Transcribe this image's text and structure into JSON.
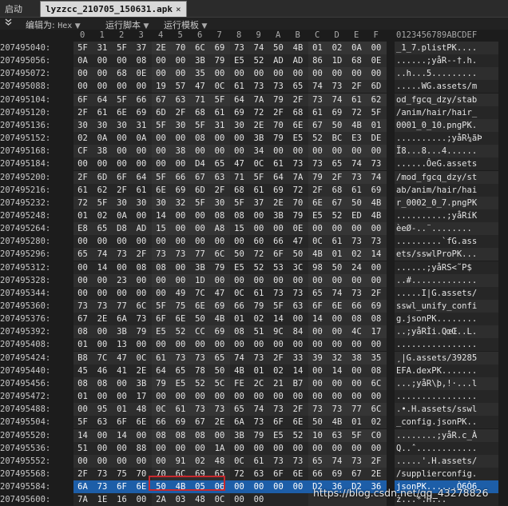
{
  "tabs": {
    "start_label": "启动",
    "file_label": "lyzzcc_210705_150631.apk",
    "close_glyph": "×"
  },
  "toolbar": {
    "edit_as_label": "编辑为:",
    "edit_as_value": "Hex",
    "run_script_label": "运行脚本",
    "run_template_label": "运行模板"
  },
  "ruler": {
    "hex_columns": [
      "0",
      "1",
      "2",
      "3",
      "4",
      "5",
      "6",
      "7",
      "8",
      "9",
      "A",
      "B",
      "C",
      "D",
      "E",
      "F"
    ],
    "ascii_header": "0123456789ABCDEF"
  },
  "rows": [
    {
      "addr": "207495040:",
      "hex": [
        "5F",
        "31",
        "5F",
        "37",
        "2E",
        "70",
        "6C",
        "69",
        "73",
        "74",
        "50",
        "4B",
        "01",
        "02",
        "0A",
        "00"
      ],
      "ascii": "_1_7.plistPK...."
    },
    {
      "addr": "207495056:",
      "hex": [
        "0A",
        "00",
        "00",
        "08",
        "00",
        "00",
        "3B",
        "79",
        "E5",
        "52",
        "AD",
        "AD",
        "86",
        "1D",
        "68",
        "0E"
      ],
      "ascii": "......;yåR--†.h."
    },
    {
      "addr": "207495072:",
      "hex": [
        "00",
        "00",
        "68",
        "0E",
        "00",
        "00",
        "35",
        "00",
        "00",
        "00",
        "00",
        "00",
        "00",
        "00",
        "00",
        "00"
      ],
      "ascii": "..h...5........."
    },
    {
      "addr": "207495088:",
      "hex": [
        "00",
        "00",
        "00",
        "00",
        "19",
        "57",
        "47",
        "0C",
        "61",
        "73",
        "73",
        "65",
        "74",
        "73",
        "2F",
        "6D"
      ],
      "ascii": ".....WG.assets/m"
    },
    {
      "addr": "207495104:",
      "hex": [
        "6F",
        "64",
        "5F",
        "66",
        "67",
        "63",
        "71",
        "5F",
        "64",
        "7A",
        "79",
        "2F",
        "73",
        "74",
        "61",
        "62"
      ],
      "ascii": "od_fgcq_dzy/stab"
    },
    {
      "addr": "207495120:",
      "hex": [
        "2F",
        "61",
        "6E",
        "69",
        "6D",
        "2F",
        "68",
        "61",
        "69",
        "72",
        "2F",
        "68",
        "61",
        "69",
        "72",
        "5F"
      ],
      "ascii": "/anim/hair/hair_"
    },
    {
      "addr": "207495136:",
      "hex": [
        "30",
        "30",
        "30",
        "31",
        "5F",
        "30",
        "5F",
        "31",
        "30",
        "2E",
        "70",
        "6E",
        "67",
        "50",
        "4B",
        "01"
      ],
      "ascii": "0001_0_10.pngPK."
    },
    {
      "addr": "207495152:",
      "hex": [
        "02",
        "0A",
        "00",
        "0A",
        "00",
        "00",
        "08",
        "00",
        "00",
        "3B",
        "79",
        "E5",
        "52",
        "BC",
        "E3",
        "DE"
      ],
      "ascii": "..........;yåR¼ãÞ"
    },
    {
      "addr": "207495168:",
      "hex": [
        "CF",
        "38",
        "00",
        "00",
        "00",
        "38",
        "00",
        "00",
        "00",
        "34",
        "00",
        "00",
        "00",
        "00",
        "00",
        "00"
      ],
      "ascii": "Ï8...8...4......"
    },
    {
      "addr": "207495184:",
      "hex": [
        "00",
        "00",
        "00",
        "00",
        "00",
        "00",
        "D4",
        "65",
        "47",
        "0C",
        "61",
        "73",
        "73",
        "65",
        "74",
        "73"
      ],
      "ascii": "......ÔeG.assets"
    },
    {
      "addr": "207495200:",
      "hex": [
        "2F",
        "6D",
        "6F",
        "64",
        "5F",
        "66",
        "67",
        "63",
        "71",
        "5F",
        "64",
        "7A",
        "79",
        "2F",
        "73",
        "74"
      ],
      "ascii": "/mod_fgcq_dzy/st"
    },
    {
      "addr": "207495216:",
      "hex": [
        "61",
        "62",
        "2F",
        "61",
        "6E",
        "69",
        "6D",
        "2F",
        "68",
        "61",
        "69",
        "72",
        "2F",
        "68",
        "61",
        "69"
      ],
      "ascii": "ab/anim/hair/hai"
    },
    {
      "addr": "207495232:",
      "hex": [
        "72",
        "5F",
        "30",
        "30",
        "30",
        "32",
        "5F",
        "30",
        "5F",
        "37",
        "2E",
        "70",
        "6E",
        "67",
        "50",
        "4B"
      ],
      "ascii": "r_0002_0_7.pngPK"
    },
    {
      "addr": "207495248:",
      "hex": [
        "01",
        "02",
        "0A",
        "00",
        "14",
        "00",
        "00",
        "08",
        "08",
        "00",
        "3B",
        "79",
        "E5",
        "52",
        "ED",
        "4B"
      ],
      "ascii": "..........;yåRíK"
    },
    {
      "addr": "207495264:",
      "hex": [
        "E8",
        "65",
        "D8",
        "AD",
        "15",
        "00",
        "00",
        "A8",
        "15",
        "00",
        "00",
        "0E",
        "00",
        "00",
        "00",
        "00"
      ],
      "ascii": "èeØ-..¨........"
    },
    {
      "addr": "207495280:",
      "hex": [
        "00",
        "00",
        "00",
        "00",
        "00",
        "00",
        "00",
        "00",
        "00",
        "60",
        "66",
        "47",
        "0C",
        "61",
        "73",
        "73"
      ],
      "ascii": ".........`fG.ass"
    },
    {
      "addr": "207495296:",
      "hex": [
        "65",
        "74",
        "73",
        "2F",
        "73",
        "73",
        "77",
        "6C",
        "50",
        "72",
        "6F",
        "50",
        "4B",
        "01",
        "02",
        "14"
      ],
      "ascii": "ets/sswlProPK..."
    },
    {
      "addr": "207495312:",
      "hex": [
        "00",
        "14",
        "00",
        "08",
        "08",
        "00",
        "3B",
        "79",
        "E5",
        "52",
        "53",
        "3C",
        "98",
        "50",
        "24",
        "00"
      ],
      "ascii": "......;yåRS<˜P$"
    },
    {
      "addr": "207495328:",
      "hex": [
        "00",
        "00",
        "23",
        "00",
        "00",
        "00",
        "1D",
        "00",
        "00",
        "00",
        "00",
        "00",
        "00",
        "00",
        "00",
        "00"
      ],
      "ascii": "..#............."
    },
    {
      "addr": "207495344:",
      "hex": [
        "00",
        "00",
        "00",
        "00",
        "00",
        "49",
        "7C",
        "47",
        "0C",
        "61",
        "73",
        "73",
        "65",
        "74",
        "73",
        "2F"
      ],
      "ascii": ".....I|G.assets/"
    },
    {
      "addr": "207495360:",
      "hex": [
        "73",
        "73",
        "77",
        "6C",
        "5F",
        "75",
        "6E",
        "69",
        "66",
        "79",
        "5F",
        "63",
        "6F",
        "6E",
        "66",
        "69"
      ],
      "ascii": "sswl_unify_confi"
    },
    {
      "addr": "207495376:",
      "hex": [
        "67",
        "2E",
        "6A",
        "73",
        "6F",
        "6E",
        "50",
        "4B",
        "01",
        "02",
        "14",
        "00",
        "14",
        "00",
        "08",
        "08"
      ],
      "ascii": "g.jsonPK........"
    },
    {
      "addr": "207495392:",
      "hex": [
        "08",
        "00",
        "3B",
        "79",
        "E5",
        "52",
        "CC",
        "69",
        "08",
        "51",
        "9C",
        "84",
        "00",
        "00",
        "4C",
        "17"
      ],
      "ascii": "..;yåRÌi.QœŒ..L."
    },
    {
      "addr": "207495408:",
      "hex": [
        "01",
        "00",
        "13",
        "00",
        "00",
        "00",
        "00",
        "00",
        "00",
        "00",
        "00",
        "00",
        "00",
        "00",
        "00",
        "00"
      ],
      "ascii": "................"
    },
    {
      "addr": "207495424:",
      "hex": [
        "B8",
        "7C",
        "47",
        "0C",
        "61",
        "73",
        "73",
        "65",
        "74",
        "73",
        "2F",
        "33",
        "39",
        "32",
        "38",
        "35"
      ],
      "ascii": "¸|G.assets/39285"
    },
    {
      "addr": "207495440:",
      "hex": [
        "45",
        "46",
        "41",
        "2E",
        "64",
        "65",
        "78",
        "50",
        "4B",
        "01",
        "02",
        "14",
        "00",
        "14",
        "00",
        "08"
      ],
      "ascii": "EFA.dexPK......."
    },
    {
      "addr": "207495456:",
      "hex": [
        "08",
        "08",
        "00",
        "3B",
        "79",
        "E5",
        "52",
        "5C",
        "FE",
        "2C",
        "21",
        "B7",
        "00",
        "00",
        "00",
        "6C"
      ],
      "ascii": "...;yåR\\þ,!·...l"
    },
    {
      "addr": "207495472:",
      "hex": [
        "01",
        "00",
        "00",
        "17",
        "00",
        "00",
        "00",
        "00",
        "00",
        "00",
        "00",
        "00",
        "00",
        "00",
        "00",
        "00"
      ],
      "ascii": "................"
    },
    {
      "addr": "207495488:",
      "hex": [
        "00",
        "95",
        "01",
        "48",
        "0C",
        "61",
        "73",
        "73",
        "65",
        "74",
        "73",
        "2F",
        "73",
        "73",
        "77",
        "6C"
      ],
      "ascii": ".•.H.assets/sswl"
    },
    {
      "addr": "207495504:",
      "hex": [
        "5F",
        "63",
        "6F",
        "6E",
        "66",
        "69",
        "67",
        "2E",
        "6A",
        "73",
        "6F",
        "6E",
        "50",
        "4B",
        "01",
        "02"
      ],
      "ascii": "_config.jsonPK.."
    },
    {
      "addr": "207495520:",
      "hex": [
        "14",
        "00",
        "14",
        "00",
        "08",
        "08",
        "08",
        "00",
        "3B",
        "79",
        "E5",
        "52",
        "10",
        "63",
        "5F",
        "C0"
      ],
      "ascii": "........;yåR.c_À"
    },
    {
      "addr": "207495536:",
      "hex": [
        "51",
        "00",
        "00",
        "88",
        "00",
        "00",
        "00",
        "1A",
        "00",
        "00",
        "00",
        "00",
        "00",
        "00",
        "00",
        "00"
      ],
      "ascii": "Q..ˆ............"
    },
    {
      "addr": "207495552:",
      "hex": [
        "00",
        "00",
        "00",
        "00",
        "00",
        "91",
        "02",
        "48",
        "0C",
        "61",
        "73",
        "73",
        "65",
        "74",
        "73",
        "2F"
      ],
      "ascii": ".....'.H.assets/"
    },
    {
      "addr": "207495568:",
      "hex": [
        "2F",
        "73",
        "75",
        "70",
        "70",
        "6C",
        "69",
        "65",
        "72",
        "63",
        "6F",
        "6E",
        "66",
        "69",
        "67",
        "2E"
      ],
      "ascii": "/supplierconfig."
    },
    {
      "addr": "207495584:",
      "hex": [
        "6A",
        "73",
        "6F",
        "6E",
        "50",
        "4B",
        "05",
        "06",
        "00",
        "00",
        "00",
        "00",
        "D2",
        "36",
        "D2",
        "36"
      ],
      "ascii": "jsonPK......Ò6Ò6",
      "selected": true
    },
    {
      "addr": "207495600:",
      "hex": [
        "7A",
        "1E",
        "16",
        "00",
        "2A",
        "03",
        "48",
        "0C",
        "00",
        "00",
        "",
        "",
        "",
        "",
        "",
        ""
      ],
      "ascii": "z...*.H..."
    }
  ],
  "watermark": "https://blog.csdn.net/qq_43278826",
  "colors": {
    "background": "#1c1c1c",
    "selection": "#1d5ea8",
    "highlight_box": "#c8282d",
    "file_tab": "#d9d9d9"
  }
}
